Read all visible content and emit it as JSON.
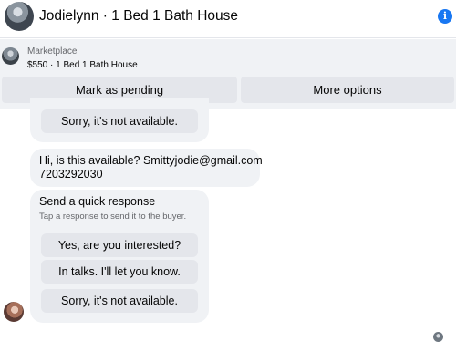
{
  "header": {
    "title": "Jodielynn · 1 Bed 1 Bath House",
    "avatar_icon": "profile-photo",
    "info_icon": "info-icon",
    "info_glyph": "i",
    "accent": "#1877f2"
  },
  "listing": {
    "kind": "Marketplace",
    "price_title": "$550 · 1 Bed 1 Bath House",
    "mark_pending_label": "Mark as pending",
    "more_options_label": "More options"
  },
  "conversation": {
    "top_reply_label": "Sorry, it's not available.",
    "message_lines": [
      "Hi, is this available? Smittyjodie@gmail.com",
      "7203292030"
    ],
    "quick_response": {
      "title": "Send a quick response",
      "subtitle": "Tap a response to send it to the buyer.",
      "replies": [
        "Yes, are you interested?",
        "In talks. I'll let you know.",
        "Sorry, it's not available."
      ]
    }
  }
}
